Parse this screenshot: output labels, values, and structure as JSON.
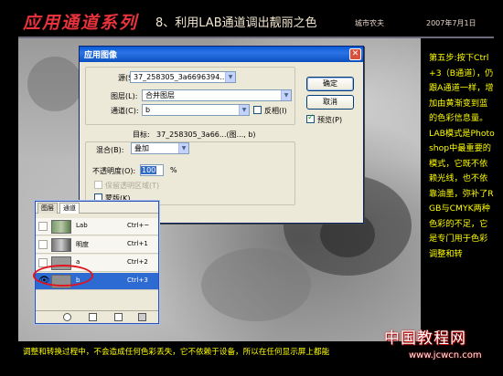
{
  "header": {
    "title": "应用通道系列",
    "subtitle": "8、利用LAB通道调出靓丽之色",
    "author": "城市农夫",
    "date": "2007年7月1日"
  },
  "dialog": {
    "title": "应用图像",
    "close_glyph": "✕",
    "source_label": "源(S):",
    "source_value": "37_258305_3a6696394...",
    "layer_label": "图层(L):",
    "layer_value": "合并图层",
    "channel_label": "通道(C):",
    "channel_value": "b",
    "invert_label": "反相(I)",
    "invert_checked": false,
    "target_label": "目标:",
    "target_value": "37_258305_3a66...(图..., b)",
    "blend_label": "混合(B):",
    "blend_value": "叠加",
    "opacity_label": "不透明度(O):",
    "opacity_value": "100",
    "opacity_unit": "%",
    "preserve_label": "保留透明区域(T)",
    "mask_label": "蒙版(K)...",
    "ok_label": "确定",
    "cancel_label": "取消",
    "preview_label": "预览(P)",
    "preview_checked": true
  },
  "channels_panel": {
    "tabs": [
      "图层",
      "通道"
    ],
    "rows": [
      {
        "name": "Lab",
        "shortcut": "Ctrl+~",
        "selected": false
      },
      {
        "name": "明度",
        "shortcut": "Ctrl+1",
        "selected": false
      },
      {
        "name": "a",
        "shortcut": "Ctrl+2",
        "selected": false
      },
      {
        "name": "b",
        "shortcut": "Ctrl+3",
        "selected": true
      }
    ]
  },
  "sidebar_text": {
    "step": "第五步:按下Ctrl+3（B通道），仍跟A通道一样，增加由黄渐变到蓝的色彩信息量。",
    "note": "LAB模式是Photoshop中最重要的模式，它既不依赖光线，也不依靠油墨，弥补了RGB与CMYK两种色彩的不足，它是专门用于色彩调整和转"
  },
  "bottom_text": "调整和转换过程中，不会造成任何色彩丢失，它不依赖于设备，所以在任何显示屏上都能",
  "watermark": {
    "line1": "中国教程网",
    "line2": "www.jcwcn.com"
  },
  "colors": {
    "title_red": "#e8323c",
    "text_yellow": "#ffff00",
    "selection_blue": "#2d6ad2",
    "titlebar_blue": "#0a5bd6"
  }
}
